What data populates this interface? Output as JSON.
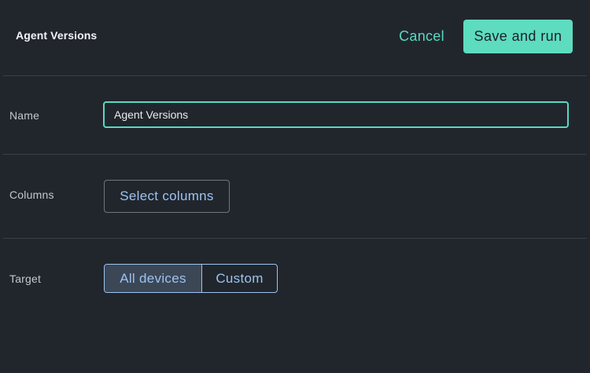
{
  "header": {
    "title": "Agent Versions",
    "cancel_label": "Cancel",
    "save_label": "Save and run"
  },
  "form": {
    "name": {
      "label": "Name",
      "value": "Agent Versions"
    },
    "columns": {
      "label": "Columns",
      "button_label": "Select columns"
    },
    "target": {
      "label": "Target",
      "options": [
        "All devices",
        "Custom"
      ],
      "selected": "All devices"
    }
  },
  "colors": {
    "background": "#21262d",
    "accent": "#5ddcc0",
    "link_blue": "#9cc3f0",
    "divider": "#3a4048"
  }
}
